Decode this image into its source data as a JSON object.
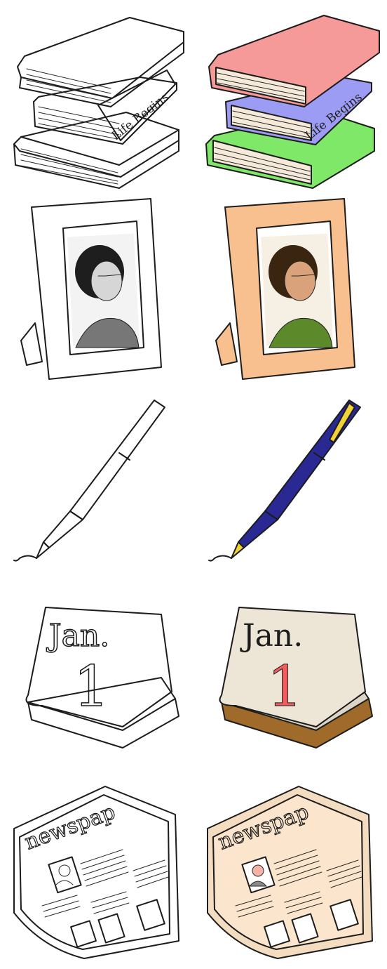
{
  "books": {
    "spine_text": "Life Begins"
  },
  "calendar": {
    "month": "Jan.",
    "day": "1"
  },
  "newspaper": {
    "masthead": "newspap"
  },
  "colors": {
    "book_top": "#f59a98",
    "book_middle": "#9d9cf4",
    "book_bottom": "#7fe869",
    "pages": "#f5ead9",
    "frame": "#f9c08f",
    "pen_body": "#2a2892",
    "pen_clip": "#f2d23a",
    "calendar_page": "#ede6d7",
    "calendar_base": "#a06a2a",
    "calendar_day": "#f25c5f",
    "newspaper_paper": "#fbe5cc",
    "newspaper_face": "#f4b3a5",
    "newspaper_shirt": "#8a8a8a"
  }
}
